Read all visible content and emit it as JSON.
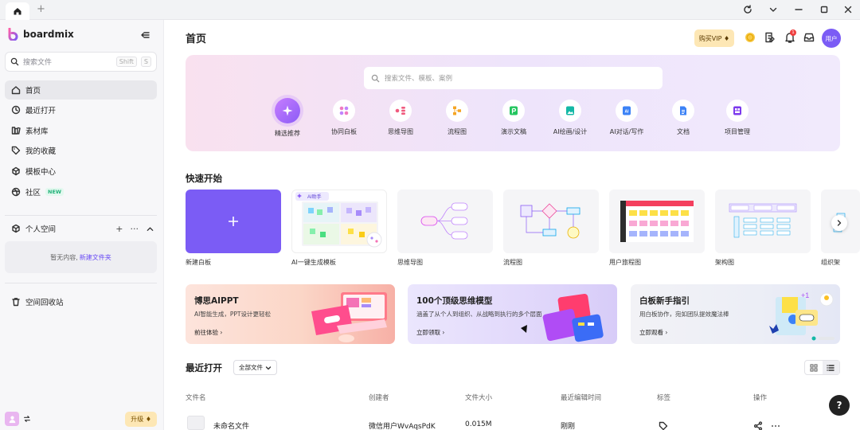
{
  "titlebar": {
    "add_tab": "+"
  },
  "sidebar": {
    "logo_text": "boardmix",
    "search": {
      "placeholder": "搜索文件",
      "shortcut1": "Shift",
      "shortcut2": "S"
    },
    "nav": [
      {
        "label": "首页",
        "icon": "home-icon"
      },
      {
        "label": "最近打开",
        "icon": "clock-icon"
      },
      {
        "label": "素材库",
        "icon": "library-icon"
      },
      {
        "label": "我的收藏",
        "icon": "tag-icon"
      },
      {
        "label": "模板中心",
        "icon": "template-icon"
      },
      {
        "label": "社区",
        "icon": "community-icon",
        "badge": "NEW"
      }
    ],
    "space": {
      "label": "个人空间",
      "add": "+",
      "more": "···",
      "empty_text": "暂无内容,",
      "empty_link": "新建文件夹"
    },
    "trash": "空间回收站",
    "upgrade": "升级"
  },
  "main": {
    "title": "首页",
    "vip_button": "购买VIP",
    "notification_count": "1",
    "user_avatar": "用户",
    "hero": {
      "search_placeholder": "搜索文件、模板、案例",
      "categories": [
        "精选推荐",
        "协同白板",
        "思维导图",
        "流程图",
        "演示文稿",
        "AI绘画/设计",
        "AI对话/写作",
        "文档",
        "项目管理"
      ]
    },
    "quick_start": {
      "title": "快速开始",
      "ai_tag": "AI助手",
      "items": [
        "新建白板",
        "AI一键生成模板",
        "思维导图",
        "流程图",
        "用户旅程图",
        "架构图",
        "组织架"
      ]
    },
    "banners": [
      {
        "title": "博思AIPPT",
        "desc": "AI智能生成，PPT设计更轻松",
        "link": "前往体验"
      },
      {
        "title": "100个顶级思维模型",
        "desc": "涵盖了从个人到组织、从战略到执行的多个层面",
        "link": "立即领取"
      },
      {
        "title": "白板新手指引",
        "desc": "用白板协作，宛如团队提效魔法棒",
        "link": "立即观看"
      }
    ],
    "recent": {
      "title": "最近打开",
      "filter": "全部文件",
      "columns": [
        "文件名",
        "创建者",
        "文件大小",
        "最近编辑时间",
        "标签",
        "操作"
      ],
      "rows": [
        {
          "name": "未命名文件",
          "creator": "微信用户WvAqsPdK",
          "size": "0.015M",
          "edited": "刚刚"
        }
      ]
    },
    "help": "?"
  },
  "colors": {
    "accent": "#7b5cf5",
    "vip": "#fde7b5",
    "new_badge": "#23b27a"
  }
}
